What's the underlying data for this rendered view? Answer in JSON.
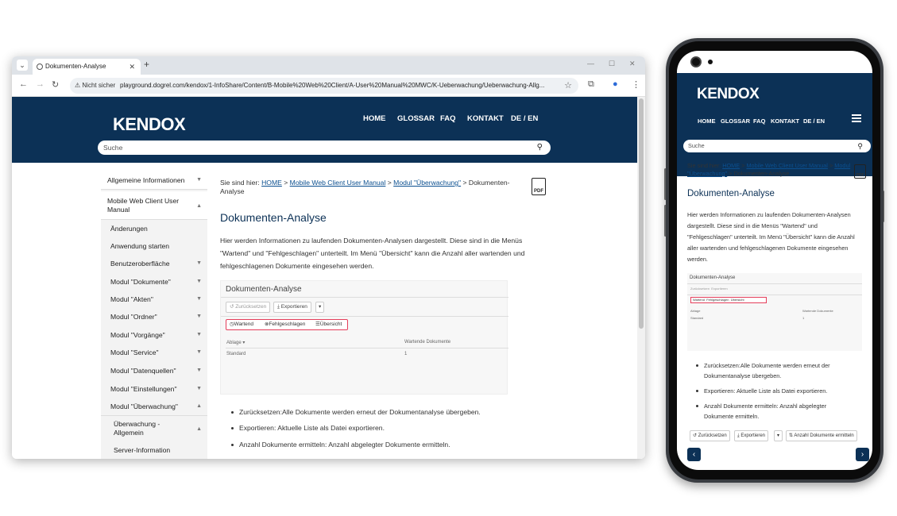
{
  "browser": {
    "tab_title": "Dokumenten-Analyse",
    "tab_menu_glyph": "⌄",
    "new_tab_glyph": "+",
    "security_label": "Nicht sicher",
    "url": "playground.dogrel.com/kendox/1-InfoShare/Content/B-Mobile%20Web%20Client/A-User%20Manual%20MWC/K-Ueberwachung/Ueberwachung-Allg..."
  },
  "site": {
    "logo": "KENDOX",
    "nav": [
      "HOME",
      "GLOSSAR",
      "FAQ",
      "KONTAKT",
      "DE / EN"
    ],
    "search_placeholder": "Suche"
  },
  "sidebar": {
    "items": [
      {
        "label": "Allgemeine Informationen",
        "chevron": "▼"
      },
      {
        "label": "Mobile Web Client User Manual",
        "chevron": "▲"
      },
      {
        "label": "Änderungen",
        "chevron": ""
      },
      {
        "label": "Anwendung starten",
        "chevron": ""
      },
      {
        "label": "Benutzeroberfläche",
        "chevron": "▼"
      },
      {
        "label": "Modul \"Dokumente\"",
        "chevron": "▼"
      },
      {
        "label": "Modul \"Akten\"",
        "chevron": "▼"
      },
      {
        "label": "Modul \"Ordner\"",
        "chevron": "▼"
      },
      {
        "label": "Modul \"Vorgänge\"",
        "chevron": "▼"
      },
      {
        "label": "Modul \"Service\"",
        "chevron": "▼"
      },
      {
        "label": "Modul \"Datenquellen\"",
        "chevron": "▼"
      },
      {
        "label": "Modul \"Einstellungen\"",
        "chevron": "▼"
      },
      {
        "label": "Modul \"Überwachung\"",
        "chevron": "▲"
      },
      {
        "label": "Überwachung - Allgemein",
        "chevron": "▲"
      },
      {
        "label": "Server-Information",
        "chevron": ""
      }
    ]
  },
  "content": {
    "breadcrumb_prefix": "Sie sind hier:",
    "crumb_home": "HOME",
    "crumb_manual": "Mobile Web Client User Manual",
    "crumb_module": "Modul \"Überwachung\"",
    "crumb_current": "Dokumenten-Analyse",
    "crumb_sep": ">",
    "pdf_label": "PDF",
    "title": "Dokumenten-Analyse",
    "paragraph": "Hier werden Informationen zu laufenden Dokumenten-Analysen dargestellt. Diese sind in die Menüs \"Wartend\" und \"Fehlgeschlagen\" unterteilt. Im Menü \"Übersicht\" kann die Anzahl aller wartenden und fehlgeschlagenen Dokumente eingesehen werden.",
    "screenshot": {
      "title": "Dokumenten-Analyse",
      "reset": "Zurücksetzen",
      "export": "Exportieren",
      "tab_waiting": "Wartend",
      "tab_failed": "Fehlgeschlagen",
      "tab_overview": "Übersicht",
      "col_storage": "Ablage",
      "col_waiting": "Wartende Dokumente",
      "row_storage": "Standard",
      "row_count": "1"
    },
    "bullets": [
      "Zurücksetzen:Alle Dokumente werden erneut der Dokumentanalyse übergeben.",
      "Exportieren: Aktuelle Liste als Datei exportieren.",
      "Anzahl Dokumente ermitteln: Anzahl abgelegter Dokumente ermitteln."
    ]
  },
  "phone": {
    "toolbar": {
      "reset": "Zurücksetzen",
      "export": "Exportieren",
      "count": "Anzahl Dokumente ermitteln"
    },
    "bullet_lines": [
      [
        "Zurücksetzen:Alle Dokumente werden erneut der",
        "Dokumentanalyse übergeben."
      ],
      [
        "Exportieren: Aktuelle Liste als Datei exportieren."
      ],
      [
        "Anzahl Dokumente ermitteln: Anzahl abgelegter",
        "Dokumente ermitteln."
      ]
    ],
    "paragraph_lines": [
      "Hier werden Informationen zu laufenden Dokumenten-Analysen",
      "dargestellt. Diese sind in die Menüs \"Wartend\" und",
      "\"Fehlgeschlagen\" unterteilt. Im Menü \"Übersicht\" kann die Anzahl",
      "aller wartenden und fehlgeschlagenen Dokumente eingesehen",
      "werden."
    ],
    "prev_glyph": "‹",
    "next_glyph": "›"
  },
  "colors": {
    "brand_navy": "#0c3156",
    "link_blue": "#0b4f8f",
    "highlight_red": "#e53e5b"
  }
}
